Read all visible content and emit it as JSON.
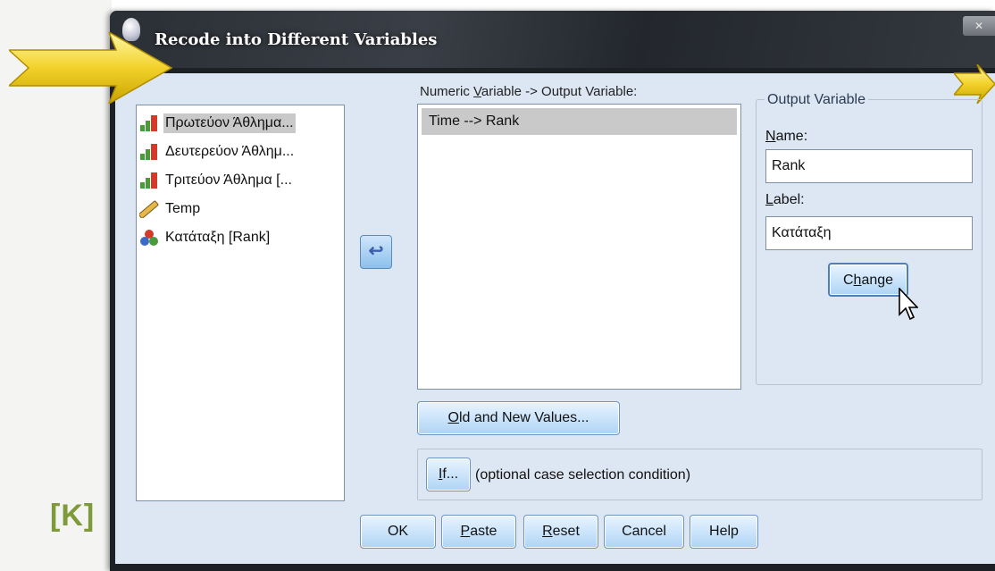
{
  "watermark": "[K]",
  "window": {
    "title": "Recode into Different Variables",
    "close_label": "✕"
  },
  "variables": [
    {
      "label": "Πρωτεύον Άθλημα...",
      "icon": "scale-bar-chart-icon",
      "selected": true
    },
    {
      "label": "Δευτερεύον Άθλημ...",
      "icon": "scale-bar-chart-icon",
      "selected": false
    },
    {
      "label": "Τριτεύον Άθλημα [...",
      "icon": "scale-bar-chart-icon",
      "selected": false
    },
    {
      "label": "Temp",
      "icon": "ruler-icon",
      "selected": false
    },
    {
      "label": "Κατάταξη [Rank]",
      "icon": "nominal-circles-icon",
      "selected": false
    }
  ],
  "move_button": {
    "icon": "arrow-left-icon",
    "glyph": "↩"
  },
  "numeric_variable": {
    "label": "Numeric Variable -> Output Variable:",
    "items": [
      "Time --> Rank"
    ]
  },
  "output_variable": {
    "legend": "Output Variable",
    "name_label": "Name:",
    "name_value": "Rank",
    "label_label": "Label:",
    "label_value": "Κατάταξη",
    "change_button": "Change"
  },
  "old_new_button": "Old and New Values...",
  "if_button": "If...",
  "if_description": "(optional case selection condition)",
  "footer_buttons": {
    "ok": "OK",
    "paste": "Paste",
    "reset": "Reset",
    "cancel": "Cancel",
    "help": "Help"
  },
  "colors": {
    "dialog_bg": "#dde7f3",
    "titlebar": "#2a2e35",
    "button_gradient_top": "#e9f4fd",
    "button_gradient_bottom": "#aed4f4",
    "arrow_yellow": "#f2d22a",
    "selection_gray": "#c9c9c9"
  }
}
